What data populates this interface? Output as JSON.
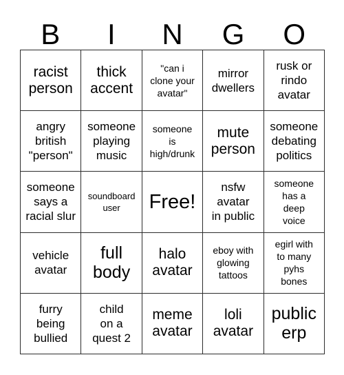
{
  "card": {
    "title": "BINGO",
    "headers": [
      "B",
      "I",
      "N",
      "G",
      "O"
    ],
    "free_space_label": "Free!",
    "colors": {
      "background": "#ffffff",
      "text": "#000000",
      "grid_line": "#2b2b2b"
    },
    "rows": [
      [
        {
          "text": "racist\nperson",
          "size": "md"
        },
        {
          "text": "thick\naccent",
          "size": "md"
        },
        {
          "text": "\"can i\nclone your\navatar\"",
          "size": "xs"
        },
        {
          "text": "mirror\ndwellers",
          "size": "sm"
        },
        {
          "text": "rusk or\nrindo\navatar",
          "size": "sm"
        }
      ],
      [
        {
          "text": "angry\nbritish\n\"person\"",
          "size": "sm"
        },
        {
          "text": "someone\nplaying\nmusic",
          "size": "sm"
        },
        {
          "text": "someone\nis\nhigh/drunk",
          "size": "xs"
        },
        {
          "text": "mute\nperson",
          "size": "md"
        },
        {
          "text": "someone\ndebating\npolitics",
          "size": "sm"
        }
      ],
      [
        {
          "text": "someone\nsays a\nracial slur",
          "size": "sm"
        },
        {
          "text": "soundboard\nuser",
          "size": "xxs"
        },
        {
          "text": "Free!",
          "size": "xl"
        },
        {
          "text": "nsfw\navatar\nin public",
          "size": "sm"
        },
        {
          "text": "someone\nhas a\ndeep\nvoice",
          "size": "xs"
        }
      ],
      [
        {
          "text": "vehicle\navatar",
          "size": "sm"
        },
        {
          "text": "full\nbody",
          "size": "lg"
        },
        {
          "text": "halo\navatar",
          "size": "md"
        },
        {
          "text": "eboy with\nglowing\ntattoos",
          "size": "xs"
        },
        {
          "text": "egirl with\nto many\npyhs\nbones",
          "size": "xs"
        }
      ],
      [
        {
          "text": "furry\nbeing\nbullied",
          "size": "sm"
        },
        {
          "text": "child\non a\nquest 2",
          "size": "sm"
        },
        {
          "text": "meme\navatar",
          "size": "md"
        },
        {
          "text": "loli\navatar",
          "size": "md"
        },
        {
          "text": "public\nerp",
          "size": "lg"
        }
      ]
    ]
  }
}
